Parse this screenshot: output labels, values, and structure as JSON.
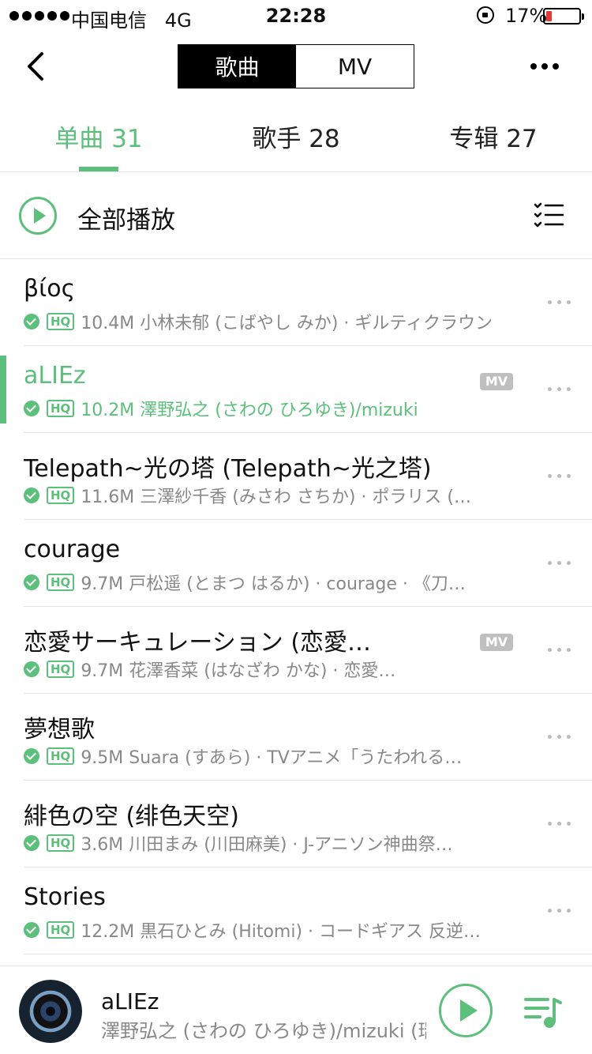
{
  "status_bar": {
    "carrier": "中国电信",
    "network": "4G",
    "time": "22:28",
    "battery_percent": "17%",
    "battery_level": 0.17
  },
  "nav": {
    "segments": [
      "歌曲",
      "MV"
    ],
    "active_segment": "歌曲"
  },
  "tabs": [
    {
      "label": "单曲 31",
      "active": true
    },
    {
      "label": "歌手 28",
      "active": false
    },
    {
      "label": "专辑 27",
      "active": false
    }
  ],
  "play_all": {
    "label": "全部播放"
  },
  "songs": [
    {
      "title": "βίος",
      "meta": "10.4M 小林未郁 (こばやし みか) · ギルティクラウン",
      "mv": false,
      "playing": false
    },
    {
      "title": "aLIEz",
      "meta": "10.2M 澤野弘之 (さわの ひろゆき)/mizuki",
      "mv": true,
      "playing": true
    },
    {
      "title": "Telepath~光の塔 (Telepath~光之塔)",
      "meta": "11.6M 三澤紗千香 (みさわ さちか) · ポラリス (…",
      "mv": false,
      "playing": false
    },
    {
      "title": "courage",
      "meta": "9.7M 戸松遥 (とまつ はるか) · courage · 《刀…",
      "mv": false,
      "playing": false
    },
    {
      "title": "恋愛サーキュレーション (恋愛…",
      "meta": "9.7M 花澤香菜 (はなざわ かな) · 恋愛…",
      "mv": true,
      "playing": false
    },
    {
      "title": "夢想歌",
      "meta": "9.5M Suara (すあら) · TVアニメ「うたわれる…",
      "mv": false,
      "playing": false
    },
    {
      "title": "緋色の空 (绯色天空)",
      "meta": "3.6M 川田まみ (川田麻美) · J-アニソン神曲祭…",
      "mv": false,
      "playing": false
    },
    {
      "title": "Stories",
      "meta": "12.2M 黒石ひとみ (Hitomi) · コードギアス 反逆…",
      "mv": false,
      "playing": false
    }
  ],
  "badges": {
    "hq": "HQ",
    "mv": "MV"
  },
  "now_playing": {
    "title": "aLIEz",
    "artist": "澤野弘之 (さわの ひろゆき)/mizuki (瑞"
  },
  "colors": {
    "accent": "#5cbf7b",
    "battery_low": "#e53935"
  },
  "icons": {
    "back": "chevron-left-icon",
    "more": "more-horizontal-icon",
    "play_all": "play-circle-icon",
    "manage": "checklist-icon",
    "downloaded": "check-circle-icon",
    "row_more": "more-horizontal-icon",
    "mini_play": "play-circle-icon",
    "playlist": "playlist-music-icon"
  }
}
